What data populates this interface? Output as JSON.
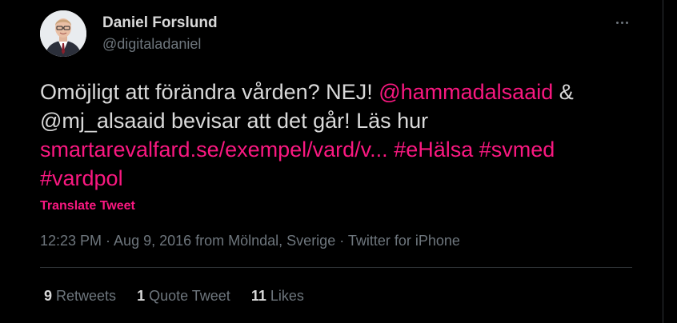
{
  "author": {
    "name": "Daniel Forslund",
    "handle": "@digitaladaniel",
    "avatar_icon": "profile-photo"
  },
  "more_icon": "more-options-icon",
  "tweet": {
    "line1_text": "Omöjligt att förändra vården? NEJ! ",
    "line1_mention": "@hammadalsaaid",
    "line1_after": " &",
    "line2_text": "@mj_alsaaid bevisar att det går! Läs hur",
    "line3_link": "smartarevalfard.se/exempel/vard/v...",
    "line3_space": " ",
    "line3_hashtag1": "#eHälsa",
    "line3_hashtag2": "#svmed",
    "line4_hashtag": "#vardpol"
  },
  "translate_label": "Translate Tweet",
  "meta": "12:23 PM · Aug 9, 2016 from Mölndal, Sverige · Twitter for iPhone",
  "stats": [
    {
      "count": "9",
      "label": "Retweets"
    },
    {
      "count": "1",
      "label": "Quote Tweet"
    },
    {
      "count": "11",
      "label": "Likes"
    }
  ],
  "colors": {
    "background": "#000000",
    "text": "#d9d9d9",
    "muted": "#6e767d",
    "accent": "#f91880",
    "border": "#2f3336"
  }
}
